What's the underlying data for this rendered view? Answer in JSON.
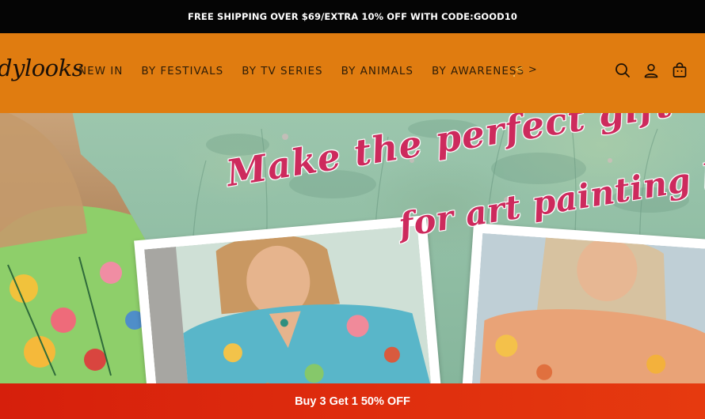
{
  "announcement": {
    "text": "FREE SHIPPING OVER $69/EXTRA 10% OFF WITH CODE:GOOD10"
  },
  "header": {
    "logo_text": "dylooks",
    "nav": [
      {
        "label": "NEW IN"
      },
      {
        "label": "BY FESTIVALS"
      },
      {
        "label": "BY TV SERIES"
      },
      {
        "label": "BY ANIMALS"
      },
      {
        "label": "BY AWARENESS"
      }
    ],
    "nav_prev": "<",
    "nav_next": ">",
    "icons": [
      "search-icon",
      "account-icon",
      "cart-icon"
    ],
    "colors": {
      "background": "#e07c10",
      "text": "#2e1d08",
      "prev_arrow": "#f4c24b"
    }
  },
  "hero": {
    "headline_line1": "Make the perfect gift",
    "headline_line2": "for art painting love",
    "colors": {
      "headline": "#cd2a5d",
      "background": "#9cc6ad"
    }
  },
  "promo_bar": {
    "text": "Buy 3 Get 1 50% OFF",
    "colors": {
      "background": "#d61f0c"
    }
  }
}
